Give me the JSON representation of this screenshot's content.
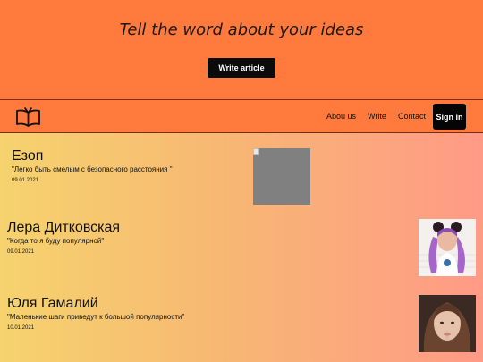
{
  "hero": {
    "title": "Tell the word about your ideas",
    "button_label": "Write article"
  },
  "nav": {
    "logo_icon": "book-icon",
    "links": [
      "Abou us",
      "Write",
      "Contact"
    ],
    "signin_label": "Sign in"
  },
  "posts": [
    {
      "author": "Езоп",
      "quote": "\"Легко быть смелым с безопасного расстояния \"",
      "date": "09.01.2021",
      "image": "broken-image"
    },
    {
      "author": "Лера Дитковская",
      "quote": "\"Когда то я буду популярной\"",
      "date": "09.01.2021",
      "image": "author-photo"
    },
    {
      "author": "Юля Гамалий",
      "quote": "\"Маленькие шаги приведут к большой популярности\"",
      "date": "10.01.2021",
      "image": "author-photo"
    }
  ],
  "colors": {
    "accent": "#ff7a3c",
    "button": "#0b0b0b",
    "gradient_start": "#f6d36e",
    "gradient_end": "#ff9a86"
  }
}
